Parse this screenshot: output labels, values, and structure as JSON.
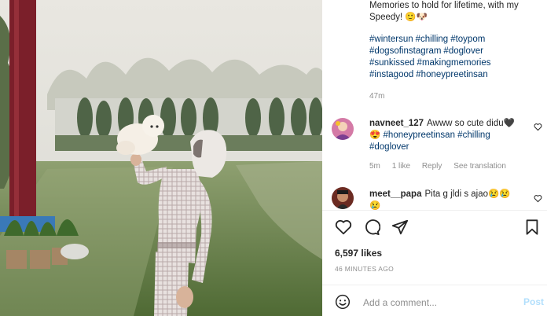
{
  "caption": {
    "text": "Memories to hold for lifetime, with my Speedy! 🙂🐶",
    "hashtags": [
      "#wintersun",
      "#chilling",
      "#toypom",
      "#dogsofinstagram",
      "#doglover",
      "#sunkissed",
      "#makingmemories",
      "#instagood",
      "#honeypreetinsan"
    ],
    "time_ago": "47m"
  },
  "comments": [
    {
      "username": "navneet_127",
      "text": "Awww so cute didu🖤 😍",
      "hashtags": [
        "#honeypreetinsan",
        "#chilling",
        "#doglover"
      ],
      "time": "5m",
      "likes": "1 like",
      "reply": "Reply",
      "translation": "See translation"
    },
    {
      "username": "meet__papa",
      "text": "Pita g jldi s ajao😢😢😢"
    }
  ],
  "actions": {
    "like_icon": "heart-icon",
    "comment_icon": "comment-icon",
    "share_icon": "share-icon",
    "save_icon": "bookmark-icon"
  },
  "likes": "6,597 likes",
  "posted": "46 MINUTES AGO",
  "add_comment": {
    "placeholder": "Add a comment...",
    "post_label": "Post",
    "emoji_icon": "smiley-icon"
  },
  "colors": {
    "hashtag": "#00376b",
    "muted": "#8e8e8e",
    "post_disabled": "#b2dffc"
  }
}
